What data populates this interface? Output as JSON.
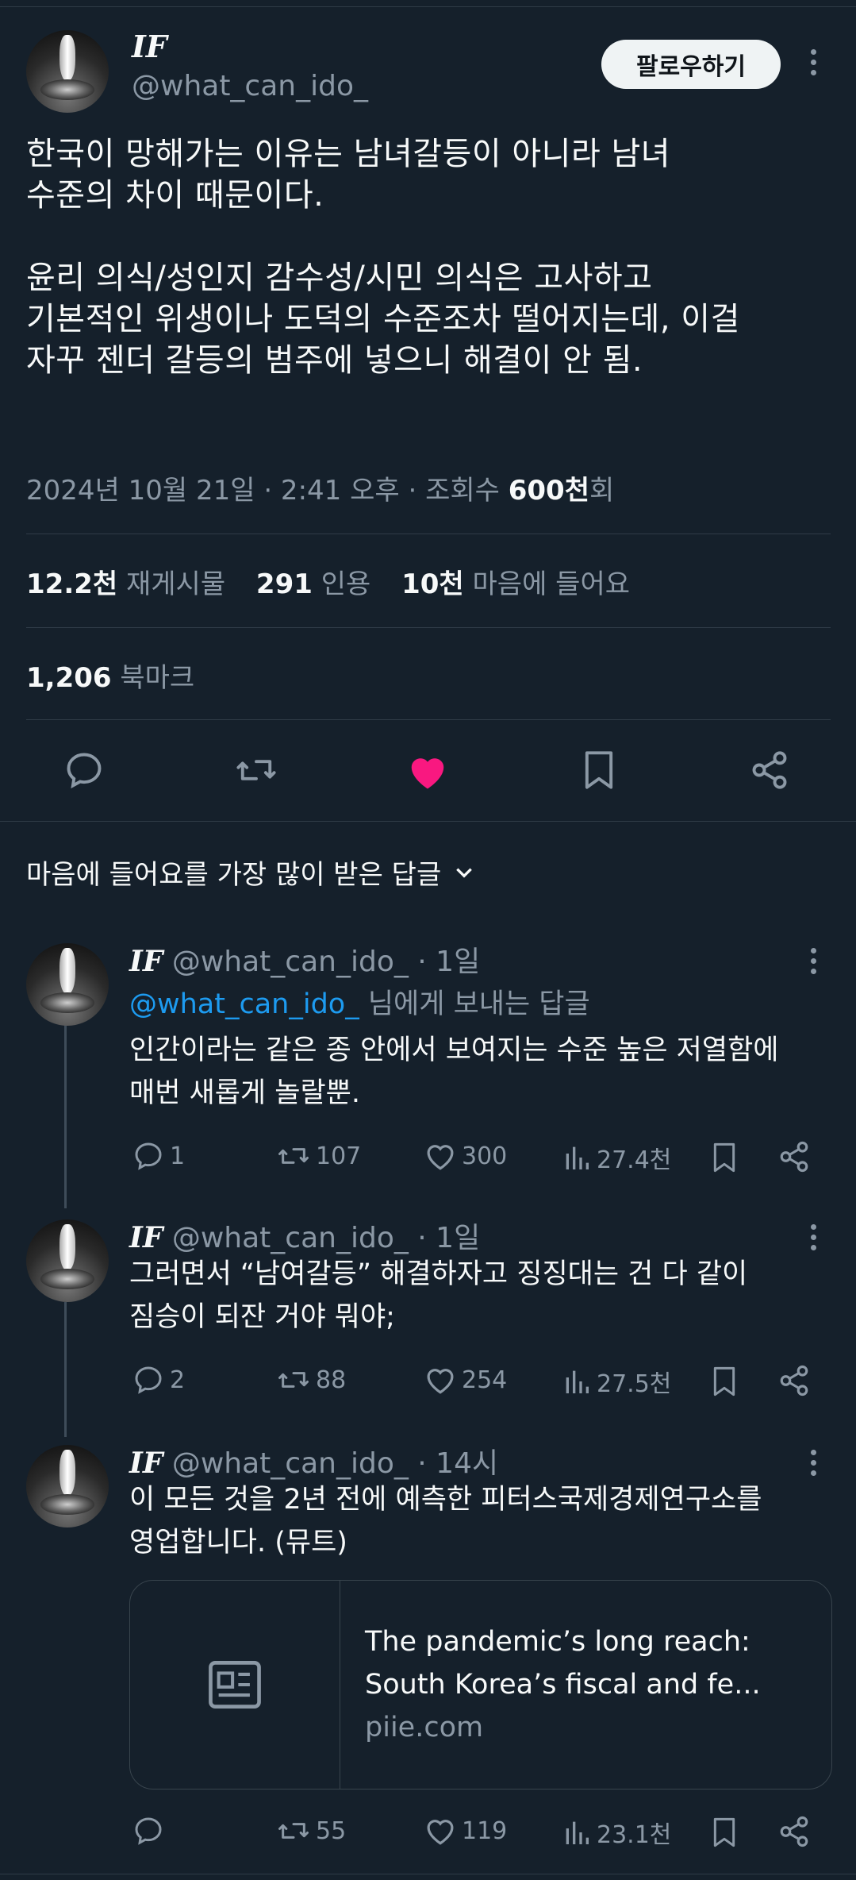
{
  "post": {
    "display_name": "IF",
    "handle": "@what_can_ido_",
    "follow_label": "팔로우하기",
    "text_lines": [
      "한국이 망해가는 이유는 남녀갈등이 아니라 남녀",
      "수준의 차이 때문이다.",
      "",
      "윤리 의식/성인지 감수성/시민 의식은 고사하고",
      "기본적인 위생이나 도덕의 수준조차 떨어지는데, 이걸",
      "자꾸 젠더 갈등의 범주에 넣으니 해결이 안 됨."
    ],
    "timestamp": "2024년 10월 21일 · 2:41 오후 · 조회수 ",
    "views": "600천",
    "views_suffix": "회",
    "reposts_count": "12.2천",
    "reposts_label": "재게시물",
    "quotes_count": "291",
    "quotes_label": "인용",
    "likes_count": "10천",
    "likes_label": "마음에 들어요",
    "bookmarks_count": "1,206",
    "bookmarks_label": "북마크",
    "liked_color": "#f91880"
  },
  "replies_sort_label": "마음에 들어요를 가장 많이 받은 답글",
  "replies": [
    {
      "display_name": "IF",
      "handle": "@what_can_ido_",
      "time": " · 1일",
      "reply_to_handle": "@what_can_ido_",
      "reply_to_suffix": " 님에게 보내는 답글",
      "text_lines": [
        "인간이라는 같은 종 안에서 보여지는 수준 높은 저열함에",
        "매번 새롭게 놀랄뿐."
      ],
      "replies": "1",
      "reposts": "107",
      "likes": "300",
      "views": "27.4천"
    },
    {
      "display_name": "IF",
      "handle": "@what_can_ido_",
      "time": " · 1일",
      "text_lines": [
        "그러면서 “남여갈등” 해결하자고 징징대는 건 다 같이",
        "짐승이 되잔 거야 뭐야;"
      ],
      "replies": "2",
      "reposts": "88",
      "likes": "254",
      "views": "27.5천"
    },
    {
      "display_name": "IF",
      "handle": "@what_can_ido_",
      "time": " · 14시",
      "text_lines": [
        "이 모든 것을 2년 전에 예측한 피터스국제경제연구소를",
        "영업합니다. (뮤트)"
      ],
      "card": {
        "title_lines": [
          "The pandemic’s long reach:",
          "South Korea’s fiscal and fe..."
        ],
        "domain": "piie.com"
      },
      "replies": "",
      "reposts": "55",
      "likes": "119",
      "views": "23.1천"
    }
  ],
  "accent_link_color": "#1d9bf0"
}
